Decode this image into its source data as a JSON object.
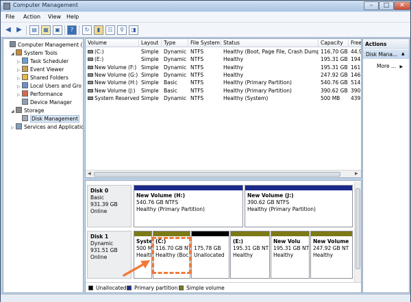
{
  "window": {
    "title": "Computer Management"
  },
  "menu": [
    "File",
    "Action",
    "View",
    "Help"
  ],
  "tree": [
    {
      "label": "Computer Management (L",
      "indent": 0,
      "icon": "computer-icon",
      "exp": ""
    },
    {
      "label": "System Tools",
      "indent": 1,
      "icon": "tools-icon",
      "exp": "◢"
    },
    {
      "label": "Task Scheduler",
      "indent": 2,
      "icon": "clock-icon",
      "exp": "▷"
    },
    {
      "label": "Event Viewer",
      "indent": 2,
      "icon": "event-icon",
      "exp": "▷"
    },
    {
      "label": "Shared Folders",
      "indent": 2,
      "icon": "folder-icon",
      "exp": "▷"
    },
    {
      "label": "Local Users and Gro",
      "indent": 2,
      "icon": "users-icon",
      "exp": "▷"
    },
    {
      "label": "Performance",
      "indent": 2,
      "icon": "performance-icon",
      "exp": "▷"
    },
    {
      "label": "Device Manager",
      "indent": 2,
      "icon": "device-icon",
      "exp": ""
    },
    {
      "label": "Storage",
      "indent": 1,
      "icon": "storage-icon",
      "exp": "◢"
    },
    {
      "label": "Disk Management",
      "indent": 2,
      "icon": "disk-icon",
      "exp": "",
      "selected": true
    },
    {
      "label": "Services and Applicatio",
      "indent": 1,
      "icon": "services-icon",
      "exp": "▷"
    }
  ],
  "list": {
    "columns": [
      "Volume",
      "Layout",
      "Type",
      "File System",
      "Status",
      "Capacity",
      "Free"
    ],
    "rows": [
      [
        "(C:)",
        "Simple",
        "Dynamic",
        "NTFS",
        "Healthy (Boot, Page File, Crash Dump)",
        "116.70 GB",
        "44.9"
      ],
      [
        "(E:)",
        "Simple",
        "Dynamic",
        "NTFS",
        "Healthy",
        "195.31 GB",
        "194."
      ],
      [
        "New Volume (F:)",
        "Simple",
        "Dynamic",
        "NTFS",
        "Healthy",
        "195.31 GB",
        "161."
      ],
      [
        "New Volume (G:)",
        "Simple",
        "Dynamic",
        "NTFS",
        "Healthy",
        "247.92 GB",
        "146."
      ],
      [
        "New Volume (H:)",
        "Simple",
        "Basic",
        "NTFS",
        "Healthy (Primary Partition)",
        "540.76 GB",
        "514."
      ],
      [
        "New Volume (J:)",
        "Simple",
        "Basic",
        "NTFS",
        "Healthy (Primary Partition)",
        "390.62 GB",
        "390."
      ],
      [
        "System Reserved",
        "Simple",
        "Dynamic",
        "NTFS",
        "Healthy (System)",
        "500 MB",
        "439"
      ]
    ]
  },
  "disks": [
    {
      "name": "Disk 0",
      "kind": "Basic",
      "size": "931.39 GB",
      "state": "Online",
      "partitions": [
        {
          "title": "New Volume  (H:)",
          "line2": "540.76 GB NTFS",
          "line3": "Healthy (Primary Partition)",
          "kind": "primary"
        },
        {
          "title": "New Volume  (J:)",
          "line2": "390.62 GB NTFS",
          "line3": "Healthy (Primary Partition)",
          "kind": "primary"
        }
      ]
    },
    {
      "name": "Disk 1",
      "kind": "Dynamic",
      "size": "931.51 GB",
      "state": "Online",
      "partitions": [
        {
          "title": "Syste",
          "line2": "500 M",
          "line3": "Healtl",
          "kind": "simple"
        },
        {
          "title": "(C:)",
          "line2": "116.70 GB NT",
          "line3": "Healthy (Boc",
          "kind": "simple"
        },
        {
          "title": "",
          "line2": "175.78 GB",
          "line3": "Unallocated",
          "kind": "unallocated"
        },
        {
          "title": "(E:)",
          "line2": "195.31 GB NT",
          "line3": "Healthy",
          "kind": "simple"
        },
        {
          "title": "New Volu",
          "line2": "195.31 GB NT",
          "line3": "Healthy",
          "kind": "simple"
        },
        {
          "title": "New Volume",
          "line2": "247.92 GB NT",
          "line3": "Healthy",
          "kind": "simple"
        }
      ]
    }
  ],
  "legend": [
    {
      "label": "Unallocated",
      "color": "#000000"
    },
    {
      "label": "Primary partition",
      "color": "#1c2a8c"
    },
    {
      "label": "Simple volume",
      "color": "#7b7a17"
    }
  ],
  "actions": {
    "title": "Actions",
    "section": "Disk Mana...",
    "more": "More ..."
  },
  "colors": {
    "primary": "#1c2a8c",
    "simple": "#7b7a17",
    "unallocated": "#000000",
    "annotation": "#ef7a3a"
  }
}
